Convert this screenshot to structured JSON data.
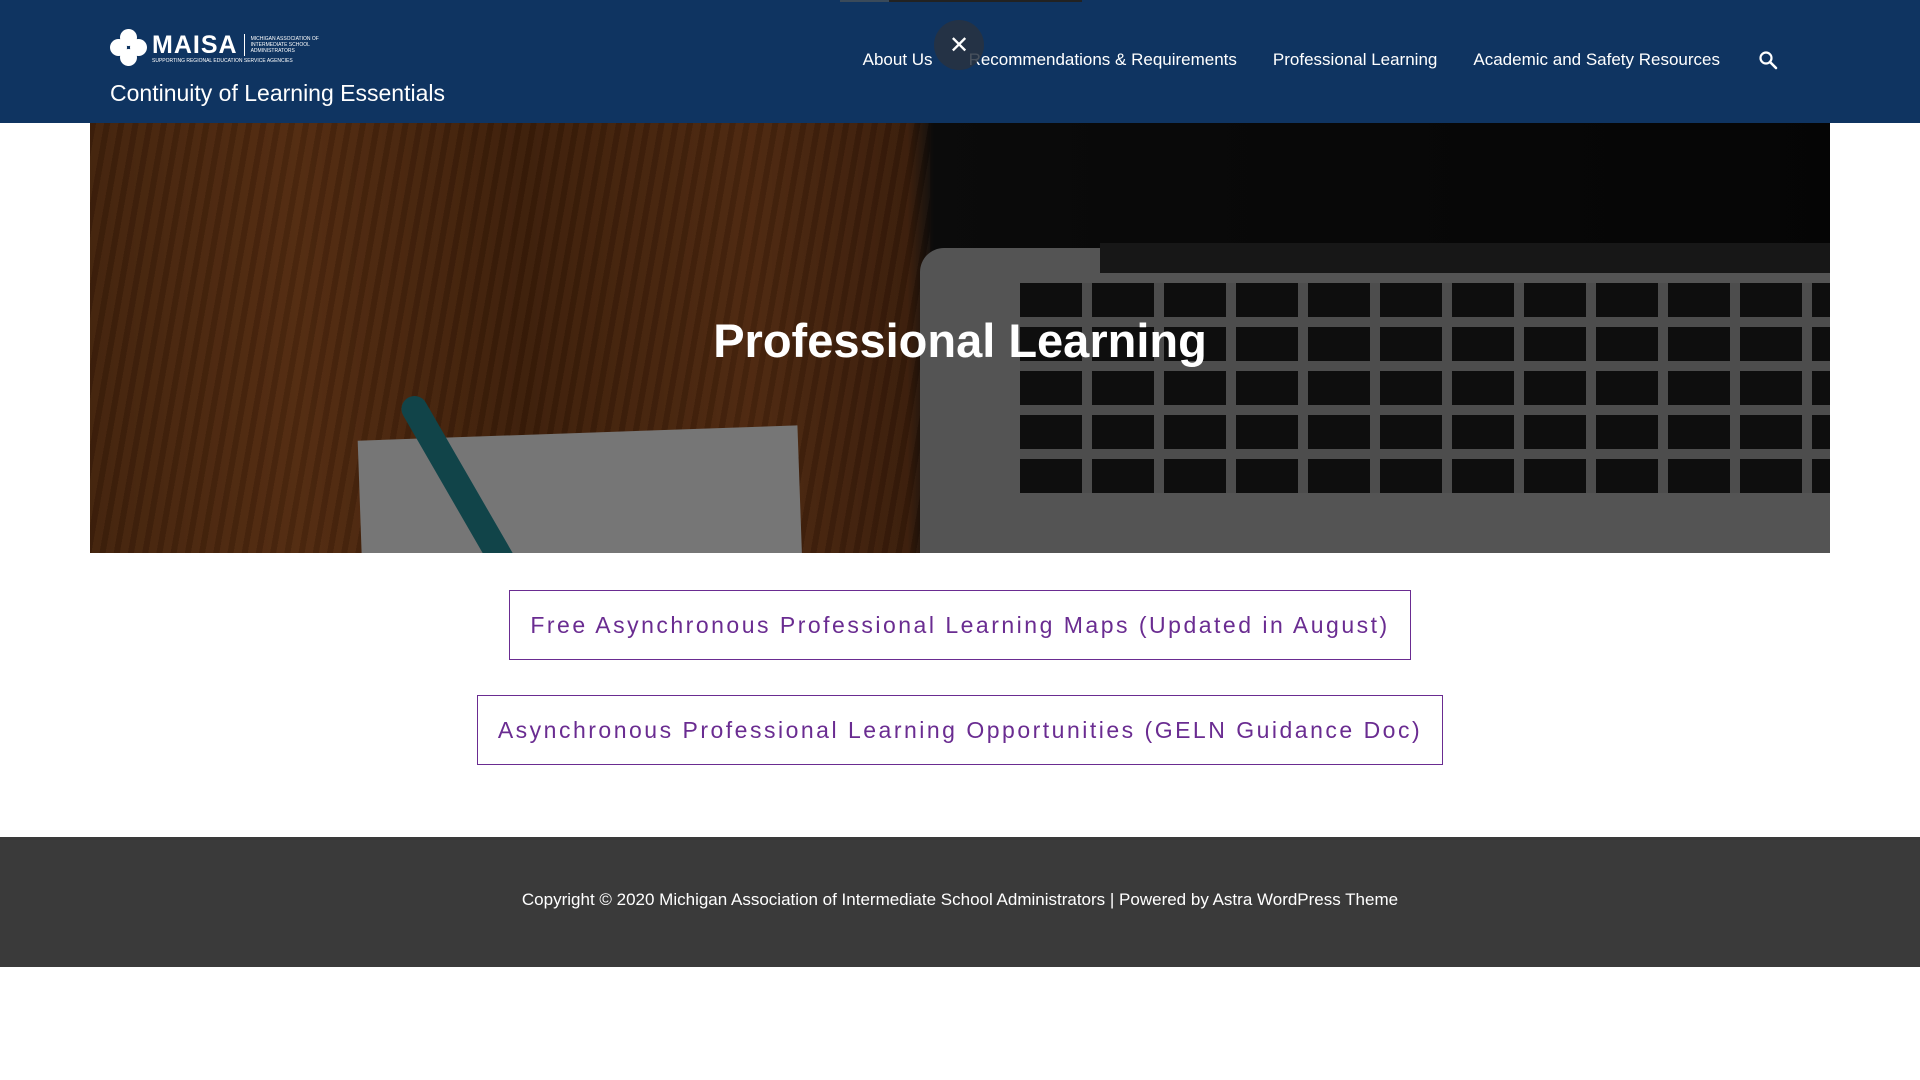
{
  "header": {
    "logo": {
      "word": "MAISA",
      "small_text": "MICHIGAN ASSOCIATION OF INTERMEDIATE SCHOOL ADMINISTRATORS",
      "tagline": "SUPPORTING REGIONAL EDUCATION SERVICE AGENCIES"
    },
    "site_title": "Continuity of Learning Essentials",
    "nav": [
      {
        "label": "About Us"
      },
      {
        "label": "Recommendations & Requirements"
      },
      {
        "label": "Professional Learning"
      },
      {
        "label": "Academic and Safety Resources"
      }
    ],
    "search_icon": "search-icon",
    "close_icon": "close-icon",
    "close_glyph": "✕",
    "colors": {
      "header_bg": "#0f3461"
    }
  },
  "hero": {
    "title": "Professional Learning"
  },
  "buttons": [
    {
      "label": "Free Asynchronous Professional Learning Maps (Updated in August)"
    },
    {
      "label": "Asynchronous Professional Learning Opportunities (GELN Guidance Doc)"
    }
  ],
  "footer": {
    "text": "Copyright © 2020 Michigan Association of Intermediate School Administrators | Powered by Astra WordPress Theme",
    "colors": {
      "footer_bg": "#3a3a3a"
    }
  },
  "colors": {
    "accent": "#6a2c91"
  }
}
